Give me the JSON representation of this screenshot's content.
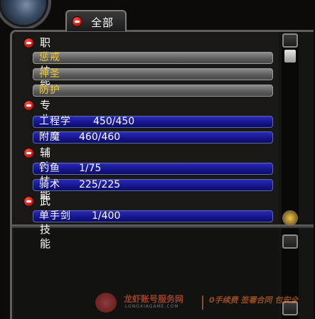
{
  "tab": {
    "label": "全部"
  },
  "categories": [
    {
      "title": "职业技能",
      "style": "gray",
      "skills": [
        {
          "name": "惩戒",
          "rank": ""
        },
        {
          "name": "神圣",
          "rank": ""
        },
        {
          "name": "防护",
          "rank": ""
        }
      ]
    },
    {
      "title": "专业",
      "style": "blue",
      "skills": [
        {
          "name": "工程学",
          "rank": "450/450"
        },
        {
          "name": "附魔",
          "rank": "460/460"
        }
      ]
    },
    {
      "title": "辅助技能",
      "style": "blue",
      "skills": [
        {
          "name": "钓鱼",
          "rank": "1/75"
        },
        {
          "name": "骑术",
          "rank": "225/225"
        }
      ]
    },
    {
      "title": "武器技能",
      "style": "blue",
      "skills": [
        {
          "name": "单手剑",
          "rank": "1/400"
        }
      ]
    }
  ],
  "watermark": {
    "title": "龙虾账号服务网",
    "subtitle": "LONGXIAGAME.COM",
    "slogan": "0手续费 签署合同 包安全"
  },
  "colors": {
    "skill_name_gray": "#f2c92e",
    "bar_blue": "#15158a",
    "bar_gray": "#6e6e6e",
    "minus_red": "#d0201a"
  }
}
